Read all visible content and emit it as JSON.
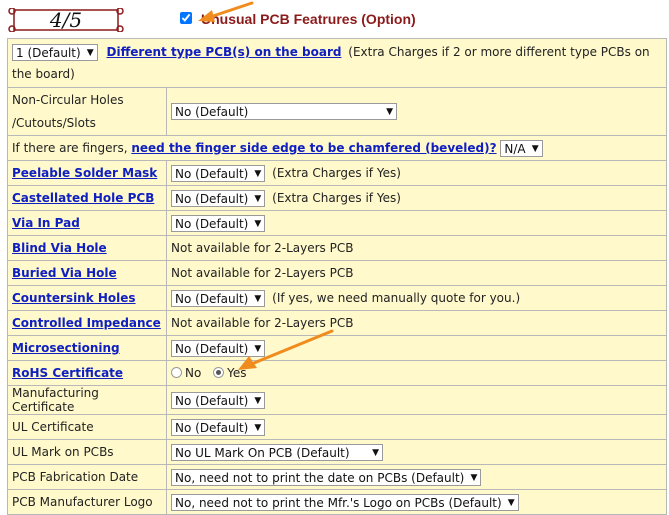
{
  "header": {
    "step": "4/5",
    "section_title": "Unusual PCB Featrures (Option)",
    "section_checked": true
  },
  "rows": {
    "diff_types": {
      "select": "1 (Default)",
      "link": "Different type PCB(s) on the board",
      "note": "(Extra Charges if 2 or more different type PCBs on the board)"
    },
    "noncircular": {
      "label": "Non-Circular Holes /Cutouts/Slots",
      "select": "No (Default)"
    },
    "fingers": {
      "prefix": "If there are fingers,",
      "link": "need the finger side edge to be chamfered (beveled)?",
      "select": "N/A"
    },
    "peelable": {
      "link": "Peelable Solder Mask",
      "select": "No (Default)",
      "note": "(Extra Charges if Yes)"
    },
    "castellated": {
      "link": "Castellated Hole PCB",
      "select": "No (Default)",
      "note": "(Extra Charges if Yes)"
    },
    "via_in_pad": {
      "link": "Via In Pad",
      "select": "No (Default)"
    },
    "blind_via": {
      "link": "Blind Via Hole",
      "text": "Not available for 2-Layers PCB"
    },
    "buried_via": {
      "link": "Buried Via Hole",
      "text": "Not available for 2-Layers PCB"
    },
    "countersink": {
      "link": "Countersink Holes",
      "select": "No (Default)",
      "note": "(If yes, we need manually quote for you.)"
    },
    "impedance": {
      "link": "Controlled Impedance",
      "text": "Not available for 2-Layers PCB"
    },
    "microsectioning": {
      "link": "Microsectioning",
      "select": "No (Default)"
    },
    "rohs": {
      "link": "RoHS Certificate",
      "option_no": "No",
      "option_yes": "Yes",
      "selected": "Yes"
    },
    "mfg_cert": {
      "label": "Manufacturing Certificate",
      "select": "No (Default)"
    },
    "ul_cert": {
      "label": "UL Certificate",
      "select": "No (Default)"
    },
    "ul_mark": {
      "label": "UL Mark on PCBs",
      "select": "No UL Mark On PCB (Default)"
    },
    "fab_date": {
      "label": "PCB Fabrication Date",
      "select": "No, need not to print the date on PCBs (Default)"
    },
    "mfr_logo": {
      "label": "PCB Manufacturer Logo",
      "select": "No, need not to print the Mfr.'s Logo on PCBs (Default)"
    }
  },
  "colors": {
    "table_bg": "#fff9cc",
    "border": "#b8b8b8",
    "link": "#1020c0",
    "title": "#8b1a1a",
    "arrow": "#f08c1e"
  }
}
